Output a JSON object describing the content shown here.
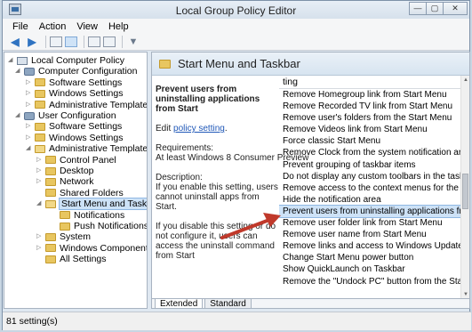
{
  "window": {
    "title": "Local Group Policy Editor",
    "controls": {
      "minimize": "—",
      "maximize": "▢",
      "close": "✕"
    }
  },
  "menubar": {
    "items": [
      "File",
      "Action",
      "View",
      "Help"
    ]
  },
  "toolbar": {
    "icons": [
      "back-arrow-icon",
      "forward-arrow-icon",
      "show-hide-tree-icon",
      "console-tree-icon",
      "export-icon",
      "properties-icon",
      "filter-icon"
    ]
  },
  "tree": {
    "items": [
      {
        "label": "Local Computer Policy",
        "level": 0,
        "expanded": true,
        "icon": "doc"
      },
      {
        "label": "Computer Configuration",
        "level": 1,
        "expanded": true,
        "icon": "gear"
      },
      {
        "label": "Software Settings",
        "level": 2,
        "expanded": false,
        "icon": "folder"
      },
      {
        "label": "Windows Settings",
        "level": 2,
        "expanded": false,
        "icon": "folder"
      },
      {
        "label": "Administrative Templates",
        "level": 2,
        "expanded": false,
        "icon": "folder"
      },
      {
        "label": "User Configuration",
        "level": 1,
        "expanded": true,
        "icon": "gear"
      },
      {
        "label": "Software Settings",
        "level": 2,
        "expanded": false,
        "icon": "folder"
      },
      {
        "label": "Windows Settings",
        "level": 2,
        "expanded": false,
        "icon": "folder"
      },
      {
        "label": "Administrative Templates",
        "level": 2,
        "expanded": true,
        "icon": "folder"
      },
      {
        "label": "Control Panel",
        "level": 3,
        "expanded": false,
        "icon": "folder"
      },
      {
        "label": "Desktop",
        "level": 3,
        "expanded": false,
        "icon": "folder"
      },
      {
        "label": "Network",
        "level": 3,
        "expanded": false,
        "icon": "folder"
      },
      {
        "label": "Shared Folders",
        "level": 3,
        "expanded": null,
        "icon": "folder"
      },
      {
        "label": "Start Menu and Taskbar",
        "level": 3,
        "expanded": true,
        "icon": "folder",
        "selected": true
      },
      {
        "label": "Notifications",
        "level": 4,
        "expanded": null,
        "icon": "folder"
      },
      {
        "label": "Push Notifications",
        "level": 4,
        "expanded": null,
        "icon": "folder"
      },
      {
        "label": "System",
        "level": 3,
        "expanded": false,
        "icon": "folder"
      },
      {
        "label": "Windows Components",
        "level": 3,
        "expanded": false,
        "icon": "folder"
      },
      {
        "label": "All Settings",
        "level": 3,
        "expanded": null,
        "icon": "folder"
      }
    ]
  },
  "detail": {
    "header_title": "Start Menu and Taskbar",
    "policy_title": "Prevent users from uninstalling applications from Start",
    "edit_prefix": "Edit ",
    "edit_link": "policy setting",
    "edit_suffix": ".",
    "requirements_label": "Requirements:",
    "requirements_value": "At least Windows 8 Consumer Preview",
    "description_label": "Description:",
    "description_1": "If you enable this setting, users cannot uninstall apps from Start.",
    "description_2": "If you disable this setting or do not configure it, users can access the uninstall command from Start"
  },
  "settings_list": {
    "column_header": "ting",
    "items": [
      "Remove Homegroup link from Start Menu",
      "Remove Recorded TV link from Start Menu",
      "Remove user's folders from the Start Menu",
      "Remove Videos link from Start Menu",
      "Force classic Start Menu",
      "Remove Clock from the system notification area",
      "Prevent grouping of taskbar items",
      "Do not display any custom toolbars in the taskbar",
      "Remove access to the context menus for the taskbar",
      "Hide the notification area",
      "Prevent users from uninstalling applications from Start",
      "Remove user folder link from Start Menu",
      "Remove user name from Start Menu",
      "Remove links and access to Windows Update",
      "Change Start Menu power button",
      "Show QuickLaunch on Taskbar",
      "Remove the \"Undock PC\" button from the Start Menu"
    ],
    "selected_index": 10
  },
  "tabs": [
    "Extended",
    "Standard"
  ],
  "status": {
    "text": "81 setting(s)"
  },
  "colors": {
    "annotation_arrow": "#c0392b",
    "selection": "#cde2f7",
    "link": "#2058b8"
  }
}
